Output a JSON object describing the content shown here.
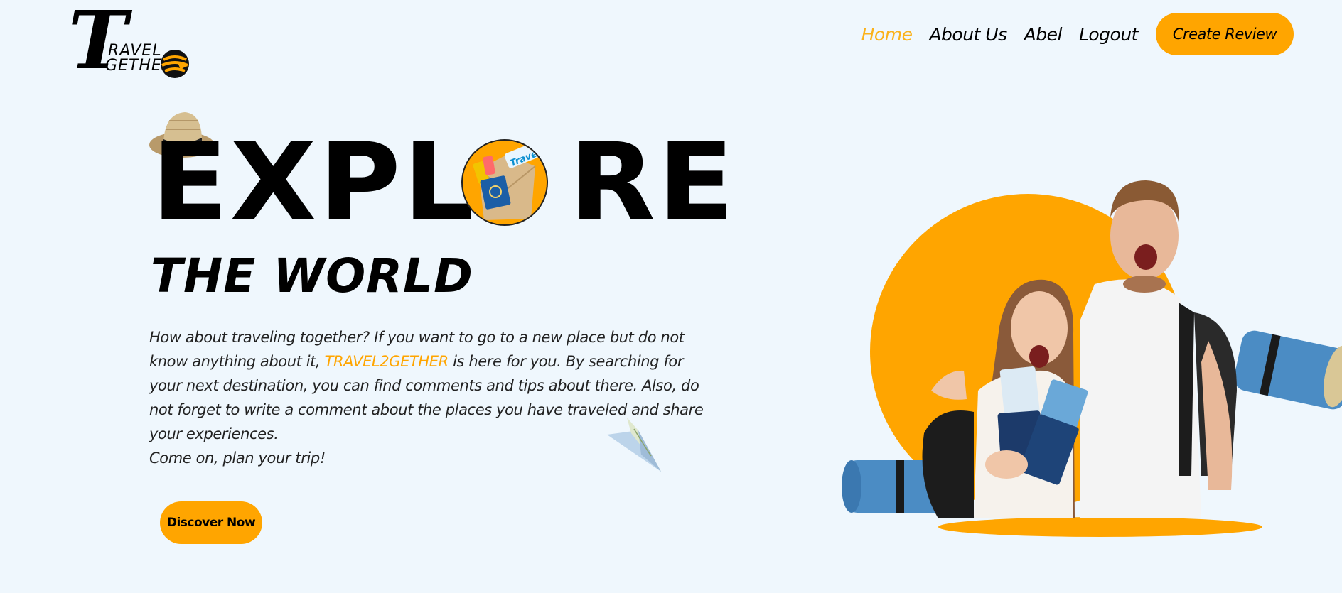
{
  "logo": {
    "big_letter": "T",
    "line1": "RAVEL",
    "line2": "GETHE"
  },
  "nav": {
    "items": [
      {
        "label": "Home",
        "active": true
      },
      {
        "label": "About Us",
        "active": false
      },
      {
        "label": "Abel",
        "active": false
      },
      {
        "label": "Logout",
        "active": false
      }
    ],
    "cta_label": "Create Review"
  },
  "hero": {
    "title_left": "EXPL",
    "title_right": "RE",
    "subtitle": "THE WORLD",
    "description_before": "How about traveling together? If you want to go to a new place but do not know anything about it, ",
    "brand": "TRAVEL2GETHER",
    "description_after": " is here for you. By searching for your next destination, you can find comments and tips about there. Also, do not forget to write a comment about the places you have traveled and share your experiences.",
    "closing": "Come on, plan your trip!",
    "button_label": "Discover Now"
  },
  "icons": {
    "hat": "hat-icon",
    "envelope": "travel-envelope-icon",
    "plane": "paper-plane-icon",
    "globe": "globe-icon"
  },
  "colors": {
    "background": "#eff7fd",
    "accent": "#ffa500",
    "active_nav": "#fbb21a",
    "text": "#000000"
  },
  "illustration": {
    "description_tag": "travelers-photo",
    "envelope_sticker": "Travel"
  }
}
